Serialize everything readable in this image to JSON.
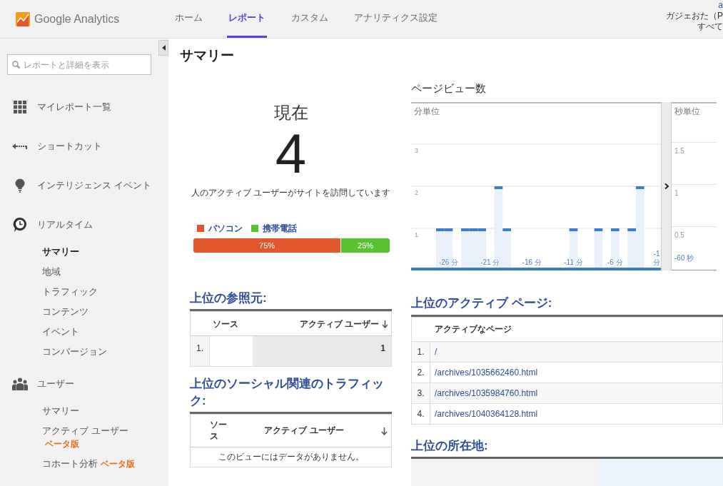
{
  "header": {
    "logo_text": "Google Analytics",
    "nav": [
      {
        "label": "ホーム",
        "selected": false
      },
      {
        "label": "レポート",
        "selected": true
      },
      {
        "label": "カスタム",
        "selected": false
      },
      {
        "label": "アナリティクス設定",
        "selected": false
      }
    ],
    "account": [
      "a",
      "ガジェおた（P",
      "すべて"
    ]
  },
  "sidebar": {
    "search": {
      "placeholder": "レポートと詳細を表示"
    },
    "sections": [
      {
        "label": "マイレポート一覧"
      },
      {
        "label": "ショートカット"
      },
      {
        "label": "インテリジェンス イベント"
      },
      {
        "label": "リアルタイム",
        "children": [
          {
            "label": "サマリー",
            "selected": true
          },
          {
            "label": "地域",
            "selected": false
          },
          {
            "label": "トラフィック",
            "selected": false
          },
          {
            "label": "コンテンツ",
            "selected": false
          },
          {
            "label": "イベント",
            "selected": false
          },
          {
            "label": "コンバージョン",
            "selected": false
          }
        ]
      },
      {
        "label": "ユーザー",
        "children": [
          {
            "label": "サマリー",
            "selected": false
          },
          {
            "label": "アクティブ ユーザー",
            "badge": "ベータ版",
            "selected": false
          },
          {
            "label": "コホート分析",
            "badge": "ベータ版",
            "selected": false
          }
        ]
      }
    ]
  },
  "page_title": "サマリー",
  "now": {
    "heading": "現在",
    "count": "4",
    "caption": "人のアクティブ ユーザーがサイトを訪問しています"
  },
  "devices": [
    {
      "name": "パソコン",
      "color": "#e0572d",
      "level": 0.75,
      "reading": "75%"
    },
    {
      "name": "携帯電話",
      "color": "#58c132",
      "level": 0.25,
      "reading": "25%"
    }
  ],
  "pageviews": {
    "title": "ページビュー数",
    "minutes": {
      "label": "分単位",
      "chart_data": {
        "type": "bar",
        "grid": true,
        "x": [
          -30,
          -29,
          -28,
          -27,
          -26,
          -25,
          -24,
          -23,
          -22,
          -21,
          -20,
          -19,
          -18,
          -17,
          -16,
          -15,
          -14,
          -13,
          -12,
          -11,
          -10,
          -9,
          -8,
          -7,
          -6,
          -5,
          -4,
          -3,
          -2,
          -1
        ],
        "values": [
          0,
          0,
          0,
          1,
          1,
          0,
          1,
          1,
          1,
          0,
          2,
          1,
          0,
          0,
          0,
          0,
          0,
          0,
          0,
          1,
          0,
          0,
          1,
          0,
          1,
          0,
          1,
          2,
          0,
          0
        ],
        "xlim": [
          -30.5,
          -0.5
        ],
        "ylim": [
          0,
          4
        ],
        "yticks": [
          1,
          2,
          3
        ],
        "xticks": [
          {
            "value": -26,
            "label": "-26 分"
          },
          {
            "value": -21,
            "label": "-21 分"
          },
          {
            "value": -16,
            "label": "-16 分"
          },
          {
            "value": -11,
            "label": "-11 分"
          },
          {
            "value": -6,
            "label": "-6 分"
          },
          {
            "value": -1,
            "label": "-1 分"
          }
        ]
      }
    },
    "seconds": {
      "label": "秒単位",
      "scale": [
        "1.5",
        "1",
        "0.5"
      ],
      "time_label": "-60 秒"
    }
  },
  "referrers": {
    "title": "上位の参照元:",
    "columns": [
      "ソース",
      "アクティブ ユーザー"
    ],
    "rows": [
      {
        "rank": "1.",
        "users": "1"
      }
    ]
  },
  "social": {
    "title": "上位のソーシャル関連のトラフィック:",
    "columns": [
      "ソース",
      "アクティブ ユーザー"
    ],
    "empty": "このビューにはデータがありません。"
  },
  "active_pages": {
    "title": "上位のアクティブ ページ:",
    "column": "アクティブなページ",
    "rows": [
      {
        "rank": "1.",
        "page": "/"
      },
      {
        "rank": "2.",
        "page": "/archives/1035662460.html"
      },
      {
        "rank": "3.",
        "page": "/archives/1035984760.html"
      },
      {
        "rank": "4.",
        "page": "/archives/1040364128.html"
      }
    ]
  },
  "locations": {
    "title": "上位の所在地:"
  }
}
